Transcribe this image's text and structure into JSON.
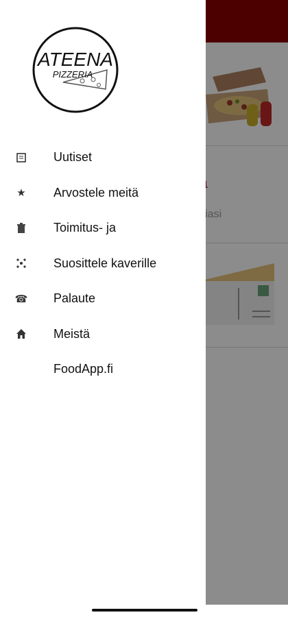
{
  "background": {
    "section_title": "toria",
    "section_subtitle": "historiasi"
  },
  "logo": {
    "name": "ATEENA",
    "subtitle": "PIZZERIA"
  },
  "menu": {
    "items": [
      {
        "label": "Uutiset",
        "icon": "newspaper-icon"
      },
      {
        "label": "Arvostele meitä",
        "icon": "star-icon"
      },
      {
        "label": "Toimitus- ja",
        "icon": "trash-icon"
      },
      {
        "label": "Suosittele kaverille",
        "icon": "share-icon"
      },
      {
        "label": "Palaute",
        "icon": "phone-icon"
      },
      {
        "label": "Meistä",
        "icon": "home-icon"
      },
      {
        "label": "FoodApp.fi",
        "icon": ""
      }
    ]
  },
  "colors": {
    "brand_red": "#8b0000",
    "accent_red": "#b0102a"
  }
}
